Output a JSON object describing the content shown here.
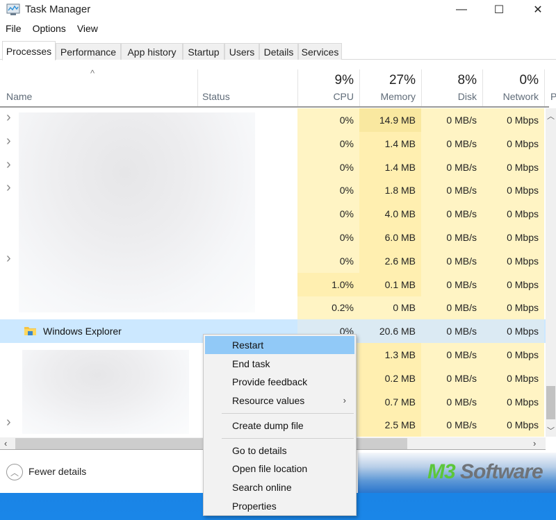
{
  "window": {
    "title": "Task Manager",
    "controls": {
      "minimize": "—",
      "maximize": "☐",
      "close": "✕"
    }
  },
  "menubar": [
    "File",
    "Options",
    "View"
  ],
  "tabs": [
    {
      "label": "Processes",
      "active": true
    },
    {
      "label": "Performance"
    },
    {
      "label": "App history"
    },
    {
      "label": "Startup"
    },
    {
      "label": "Users"
    },
    {
      "label": "Details"
    },
    {
      "label": "Services"
    }
  ],
  "columns": {
    "name": {
      "label": "Name",
      "sort_indicator": "^"
    },
    "status": {
      "label": "Status"
    },
    "cpu": {
      "percent": "9%",
      "label": "CPU"
    },
    "memory": {
      "percent": "27%",
      "label": "Memory"
    },
    "disk": {
      "percent": "8%",
      "label": "Disk"
    },
    "network": {
      "percent": "0%",
      "label": "Network"
    },
    "power": {
      "label": "P"
    }
  },
  "rows": [
    {
      "name": "",
      "expandable": true,
      "cpu": "0%",
      "memory": "14.9 MB",
      "disk": "0 MB/s",
      "network": "0 Mbps"
    },
    {
      "name": "",
      "expandable": true,
      "cpu": "0%",
      "memory": "1.4 MB",
      "disk": "0 MB/s",
      "network": "0 Mbps"
    },
    {
      "name": "",
      "expandable": true,
      "cpu": "0%",
      "memory": "1.4 MB",
      "disk": "0 MB/s",
      "network": "0 Mbps"
    },
    {
      "name": "",
      "expandable": true,
      "cpu": "0%",
      "memory": "1.8 MB",
      "disk": "0 MB/s",
      "network": "0 Mbps"
    },
    {
      "name": "",
      "expandable": false,
      "cpu": "0%",
      "memory": "4.0 MB",
      "disk": "0 MB/s",
      "network": "0 Mbps"
    },
    {
      "name": "",
      "expandable": false,
      "cpu": "0%",
      "memory": "6.0 MB",
      "disk": "0 MB/s",
      "network": "0 Mbps"
    },
    {
      "name": "",
      "expandable": true,
      "cpu": "0%",
      "memory": "2.6 MB",
      "disk": "0 MB/s",
      "network": "0 Mbps"
    },
    {
      "name": "",
      "expandable": false,
      "cpu": "1.0%",
      "memory": "0.1 MB",
      "disk": "0 MB/s",
      "network": "0 Mbps"
    },
    {
      "name": "",
      "expandable": false,
      "cpu": "0.2%",
      "memory": "0 MB",
      "disk": "0 MB/s",
      "network": "0 Mbps"
    },
    {
      "name": "Windows Explorer",
      "expandable": false,
      "selected": true,
      "icon": "folder-icon",
      "cpu": "0%",
      "memory": "20.6 MB",
      "disk": "0 MB/s",
      "network": "0 Mbps"
    },
    {
      "name": "",
      "expandable": false,
      "cpu": "",
      "memory": "1.3 MB",
      "disk": "0 MB/s",
      "network": "0 Mbps"
    },
    {
      "name": "",
      "expandable": false,
      "cpu": "",
      "memory": "0.2 MB",
      "disk": "0 MB/s",
      "network": "0 Mbps"
    },
    {
      "name": "",
      "expandable": false,
      "cpu": "",
      "memory": "0.7 MB",
      "disk": "0 MB/s",
      "network": "0 Mbps"
    },
    {
      "name": "",
      "expandable": true,
      "cpu": "",
      "memory": "2.5 MB",
      "disk": "0 MB/s",
      "network": "0 Mbps"
    }
  ],
  "context_menu": {
    "items": [
      {
        "label": "Restart",
        "hover": true
      },
      {
        "label": "End task"
      },
      {
        "label": "Provide feedback"
      },
      {
        "label": "Resource values",
        "submenu": true
      },
      {
        "separator": true
      },
      {
        "label": "Create dump file"
      },
      {
        "separator": true
      },
      {
        "label": "Go to details"
      },
      {
        "label": "Open file location"
      },
      {
        "label": "Search online"
      },
      {
        "label": "Properties"
      }
    ]
  },
  "footer": {
    "fewer_details": "Fewer details"
  },
  "watermark": {
    "part1": "M3",
    "part2": " Software"
  },
  "colors": {
    "heat_light": "#fff4c4",
    "heat_mid": "#ffefb0",
    "heat_strong": "#f9e8a0",
    "selected_row": "#cce8ff",
    "menu_hover": "#91c9f7",
    "watermark_green": "#5cc63b",
    "watermark_gray": "#6f7378"
  }
}
